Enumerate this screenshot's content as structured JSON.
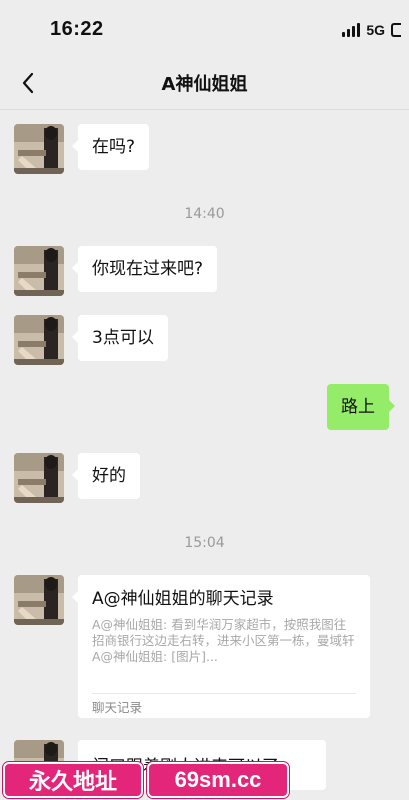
{
  "status_bar": {
    "time": "16:22",
    "network": "5G"
  },
  "nav": {
    "title": "A神仙姐姐",
    "back_icon": "chevron-left-icon"
  },
  "messages": [
    {
      "text": "在吗?"
    },
    {
      "text": "你现在过来吧?"
    },
    {
      "text": "3点可以"
    },
    {
      "text": "路上"
    },
    {
      "text": "好的"
    }
  ],
  "timestamps": [
    "14:40",
    "15:04"
  ],
  "chat_record_card": {
    "title": "A@神仙姐姐的聊天记录",
    "preview": "A@神仙姐姐: 看到华润万家超市，按照我图往招商银行这边走右转，进来小区第一栋，曼域轩\nA@神仙姐姐: [图片]...",
    "footer": "聊天记录"
  },
  "partial_message": {
    "text": "门口跟着刚人进来可以了"
  },
  "watermark": {
    "left_text": "永久地址",
    "right_text": "69sm.cc",
    "color": "#e3267a"
  },
  "colors": {
    "background": "#ededed",
    "bubble_in": "#ffffff",
    "bubble_out": "#95ec69"
  }
}
